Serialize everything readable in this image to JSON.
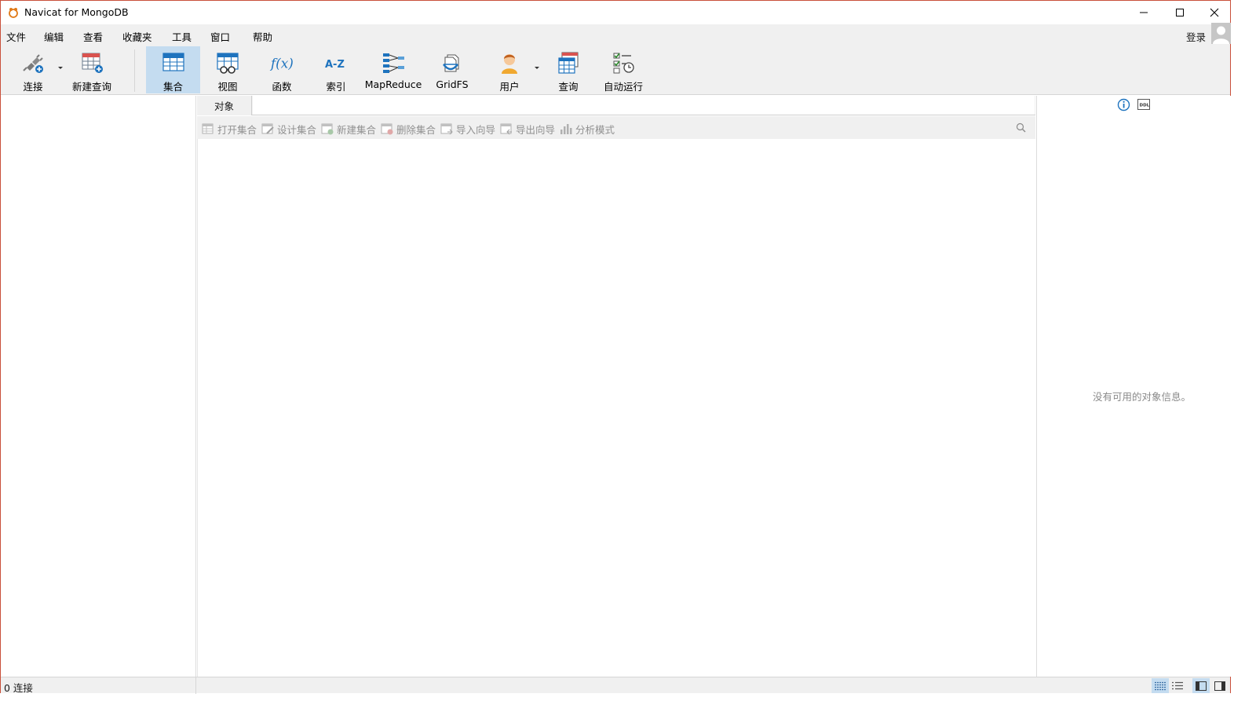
{
  "window": {
    "title": "Navicat for MongoDB"
  },
  "menu": {
    "items": [
      "文件",
      "编辑",
      "查看",
      "收藏夹",
      "工具",
      "窗口",
      "帮助"
    ],
    "login": "登录"
  },
  "toolbar": {
    "items": [
      {
        "label": "连接",
        "icon": "plug-icon"
      },
      {
        "label": "新建查询",
        "icon": "new-query-icon"
      },
      {
        "label": "集合",
        "icon": "collection-icon",
        "active": true
      },
      {
        "label": "视图",
        "icon": "view-icon"
      },
      {
        "label": "函数",
        "icon": "function-icon"
      },
      {
        "label": "索引",
        "icon": "index-icon"
      },
      {
        "label": "MapReduce",
        "icon": "mapreduce-icon"
      },
      {
        "label": "GridFS",
        "icon": "gridfs-icon"
      },
      {
        "label": "用户",
        "icon": "user-icon"
      },
      {
        "label": "查询",
        "icon": "query-icon"
      },
      {
        "label": "自动运行",
        "icon": "automation-icon"
      }
    ],
    "function_glyph": "f(x)",
    "index_glyph": "A-Z"
  },
  "tabs": {
    "objects": "对象"
  },
  "object_toolbar": {
    "buttons": [
      "打开集合",
      "设计集合",
      "新建集合",
      "删除集合",
      "导入向导",
      "导出向导",
      "分析模式"
    ]
  },
  "info_panel": {
    "empty_text": "没有可用的对象信息。",
    "ddl_label": "DDL"
  },
  "status": {
    "connections": "0 连接"
  },
  "colors": {
    "accent_blue": "#1e73be",
    "active_tool": "#c4dcf0",
    "window_border": "#c9503b"
  }
}
